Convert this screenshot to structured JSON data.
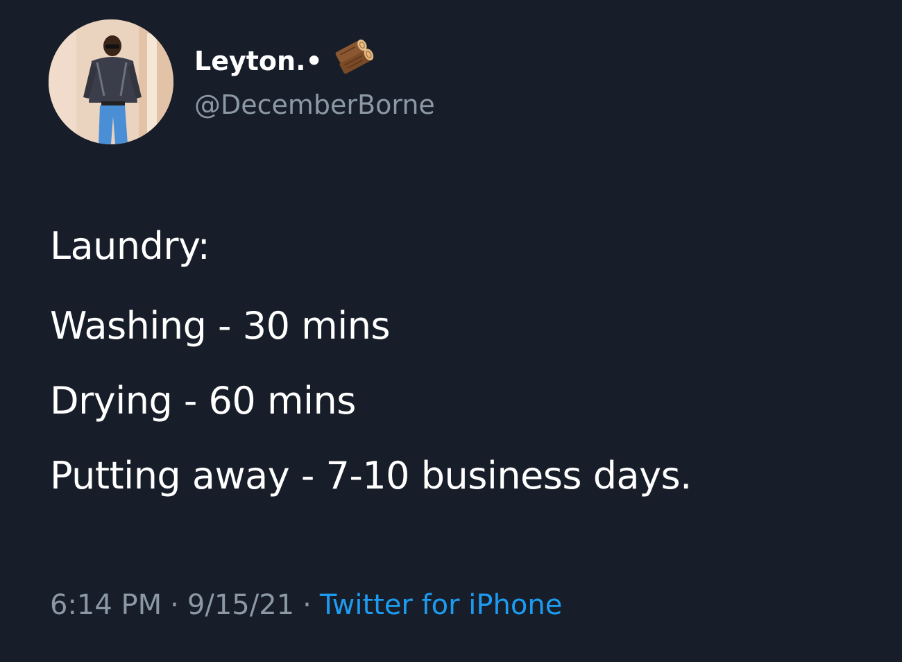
{
  "author": {
    "display_name": "Leyton.•",
    "name_emoji": "wood-log-icon",
    "handle": "@DecemberBorne"
  },
  "tweet": {
    "heading": "Laundry:",
    "lines": [
      "Washing - 30 mins",
      "Drying - 60 mins",
      "Putting away - 7-10 business days."
    ]
  },
  "meta": {
    "time": "6:14 PM",
    "separator": "·",
    "date": "9/15/21",
    "source": "Twitter for iPhone"
  },
  "colors": {
    "background": "#181e29",
    "text": "#ffffff",
    "secondary_text": "#8b98a5",
    "link": "#1d9bf0"
  }
}
